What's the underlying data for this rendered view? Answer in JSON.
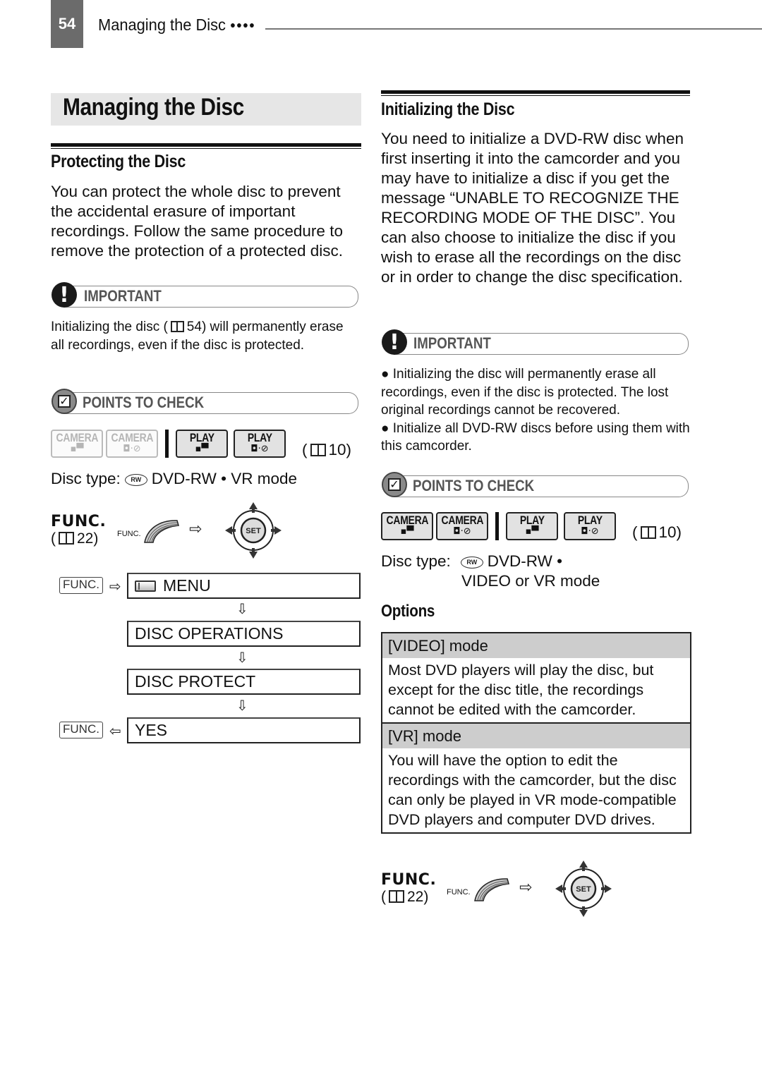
{
  "header": {
    "page_number": "54",
    "running_title": "Managing the Disc",
    "running_dots": "●●●●"
  },
  "title": "Managing the Disc",
  "left": {
    "protect": {
      "heading": "Protecting the Disc",
      "body": "You can protect the whole disc to prevent the accidental erasure of important recordings. Follow the same procedure to remove the protection of a protected disc."
    },
    "important": {
      "label": "IMPORTANT",
      "icon": "exclamation-icon",
      "text_before": "Initializing the disc (",
      "ref_page": "54",
      "text_after": ") will permanently erase all recordings, even if the disc is protected."
    },
    "points": {
      "label": "POINTS TO CHECK",
      "icon": "checkbox-icon",
      "modes": [
        {
          "label": "CAMERA",
          "sub": "movie",
          "glyph": "▪▀",
          "active": false
        },
        {
          "label": "CAMERA",
          "sub": "photo-disc",
          "glyph": "◘·⊘",
          "active": false
        },
        {
          "label": "PLAY",
          "sub": "movie",
          "glyph": "▪▀",
          "active": true
        },
        {
          "label": "PLAY",
          "sub": "photo-disc",
          "glyph": "◘·⊘",
          "active": true
        }
      ],
      "ref_page": "10",
      "disc_type_label": "Disc type:",
      "disc_icon": "RW",
      "disc_type_value": "DVD-RW • VR mode"
    },
    "func": {
      "label": "FUNC.",
      "ref_page": "22",
      "small_label": "FUNC.",
      "arrow": "⇨",
      "joystick_label": "SET"
    },
    "menu_flow": {
      "func_key": "FUNC.",
      "enter_arrow": "⇨",
      "return_arrow": "⇦",
      "down_arrow": "⇩",
      "steps": [
        "MENU",
        "DISC OPERATIONS",
        "DISC PROTECT",
        "YES"
      ]
    }
  },
  "right": {
    "init": {
      "heading": "Initializing the Disc",
      "body": "You need to initialize a DVD-RW disc when first inserting it into the camcorder and you may have to initialize a disc if you get the message “UNABLE TO RECOGNIZE THE RECORDING MODE OF THE DISC”. You can also choose to initialize the disc if you wish to erase all the recordings on the disc or in order to change the disc specification."
    },
    "important": {
      "label": "IMPORTANT",
      "bullets": [
        "Initializing the disc will permanently erase all recordings, even if the disc is protected. The lost original recordings cannot be recovered.",
        "Initialize all DVD-RW discs before using them with this camcorder."
      ]
    },
    "points": {
      "label": "POINTS TO CHECK",
      "modes": [
        {
          "label": "CAMERA",
          "glyph": "▪▀",
          "active": true
        },
        {
          "label": "CAMERA",
          "glyph": "◘·⊘",
          "active": true
        },
        {
          "label": "PLAY",
          "glyph": "▪▀",
          "active": true
        },
        {
          "label": "PLAY",
          "glyph": "◘·⊘",
          "active": true
        }
      ],
      "ref_page": "10",
      "disc_type_label": "Disc type:",
      "disc_icon": "RW",
      "disc_type_value_line1": "DVD-RW •",
      "disc_type_value_line2": "VIDEO or VR mode"
    },
    "options": {
      "heading": "Options",
      "rows": [
        {
          "name": "[VIDEO] mode",
          "desc": "Most DVD players will play the disc, but except for the disc title, the recordings cannot be edited with the camcorder."
        },
        {
          "name": "[VR] mode",
          "desc": "You will have the option to edit the recordings with the camcorder, but the disc can only be played in VR mode-compatible DVD players and computer DVD drives."
        }
      ]
    },
    "func": {
      "label": "FUNC.",
      "ref_page": "22",
      "small_label": "FUNC.",
      "arrow": "⇨",
      "joystick_label": "SET"
    }
  }
}
